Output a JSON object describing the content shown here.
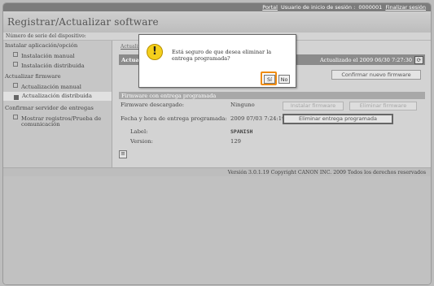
{
  "topbar": {
    "portal": "Portal",
    "user_label": "Usuario de inicio de sesión :",
    "user_id": "0000001",
    "logout": "Finalizar sesión"
  },
  "title": "Registrar/Actualizar software",
  "serial_label": "Número de serie del dispositivo:",
  "sidebar": {
    "group1": "Instalar aplicación/opción",
    "install_manual": "Instalación manual",
    "install_distributed": "Instalación distribuida",
    "group2": "Actualizar firmware",
    "update_manual": "Actualización manual",
    "update_distributed": "Actualización distribuida",
    "group3": "Confirmar servidor de entregas",
    "comm_test_line1": "Mostrar registros/Prueba de",
    "comm_test_line2": "comunicación"
  },
  "main": {
    "breadcrumb": "Actualizar",
    "panel_title": "Actualiz",
    "updated": "Actualizado el 2009 06/30 7:27:30",
    "confirm_new_fw": "Confirmar nuevo firmware",
    "section_title": "Firmware con entrega programada",
    "downloaded_label": "Firmware descargado:",
    "downloaded_value": "Ninguno",
    "install_fw": "Instalar firmware",
    "delete_fw": "Eliminar firmware",
    "date_label": "Fecha y hora de entrega programada:",
    "date_value": "2009 07/03 7:24:19",
    "delete_scheduled": "Eliminar entrega programada",
    "label_label": "Label:",
    "label_value": "SPANISH",
    "version_label": "Version:",
    "version_value": "129"
  },
  "footer": "Versión 3.0.1.19 Copyright CANON INC. 2009 Todos los derechos reservados",
  "dialog": {
    "message": "Está seguro de que desea eliminar la entrega programada?",
    "yes": "Sí",
    "no": "No"
  },
  "colors": {
    "highlight": "#ef8c12",
    "warning": "#f4cf1c"
  }
}
